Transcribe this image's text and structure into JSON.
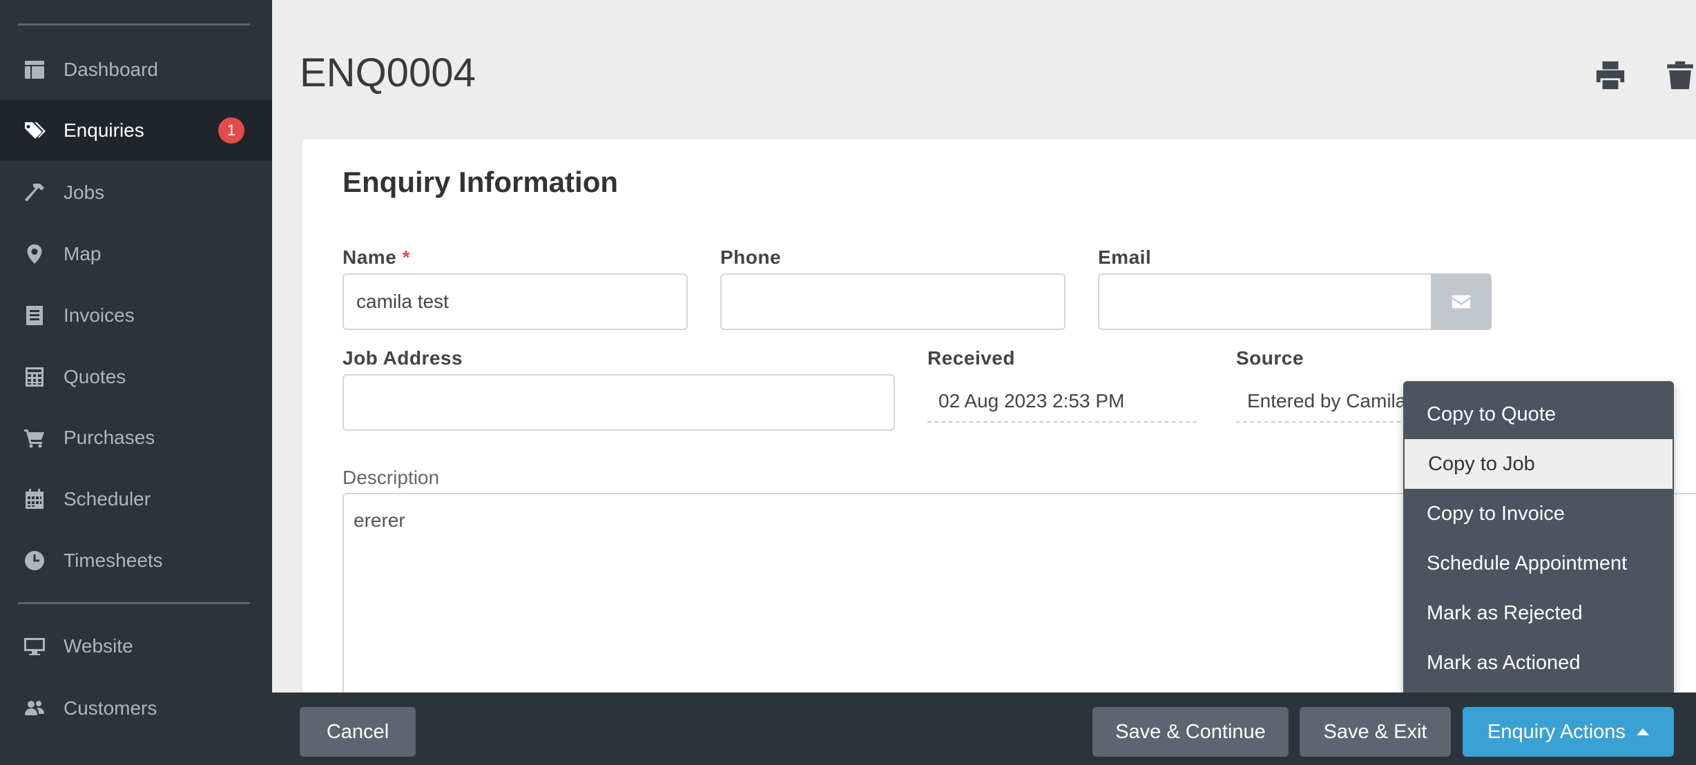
{
  "sidebar": {
    "items": [
      {
        "label": "Dashboard",
        "icon": "dashboard-icon"
      },
      {
        "label": "Enquiries",
        "icon": "tags-icon",
        "badge": "1",
        "active": true
      },
      {
        "label": "Jobs",
        "icon": "hammer-icon"
      },
      {
        "label": "Map",
        "icon": "map-marker-icon"
      },
      {
        "label": "Invoices",
        "icon": "invoice-icon"
      },
      {
        "label": "Quotes",
        "icon": "calculator-icon"
      },
      {
        "label": "Purchases",
        "icon": "cart-icon"
      },
      {
        "label": "Scheduler",
        "icon": "calendar-icon"
      },
      {
        "label": "Timesheets",
        "icon": "clock-icon"
      },
      {
        "label": "Website",
        "icon": "monitor-icon"
      },
      {
        "label": "Customers",
        "icon": "users-icon"
      }
    ]
  },
  "header": {
    "title": "ENQ0004",
    "print_icon": "print-icon",
    "delete_icon": "trash-icon"
  },
  "form": {
    "section_title": "Enquiry Information",
    "name_label": "Name",
    "required_mark": "*",
    "name_value": "camila test",
    "phone_label": "Phone",
    "phone_value": "",
    "email_label": "Email",
    "email_value": "",
    "job_address_label": "Job Address",
    "job_address_value": "",
    "received_label": "Received",
    "received_value": "02 Aug 2023 2:53 PM",
    "source_label": "Source",
    "source_value": "Entered by Camila",
    "description_label": "Description",
    "description_value": "ererer"
  },
  "actions_menu": {
    "items": [
      "Copy to Quote",
      "Copy to Job",
      "Copy to Invoice",
      "Schedule Appointment",
      "Mark as Rejected",
      "Mark as Actioned"
    ],
    "highlighted": "Copy to Job"
  },
  "footer": {
    "cancel_label": "Cancel",
    "save_continue_label": "Save & Continue",
    "save_exit_label": "Save & Exit",
    "actions_label": "Enquiry Actions"
  },
  "colors": {
    "sidebar_bg": "#2b333b",
    "badge": "#e34c4c",
    "primary_button": "#3aa1d4",
    "secondary_button": "#5b6670"
  }
}
